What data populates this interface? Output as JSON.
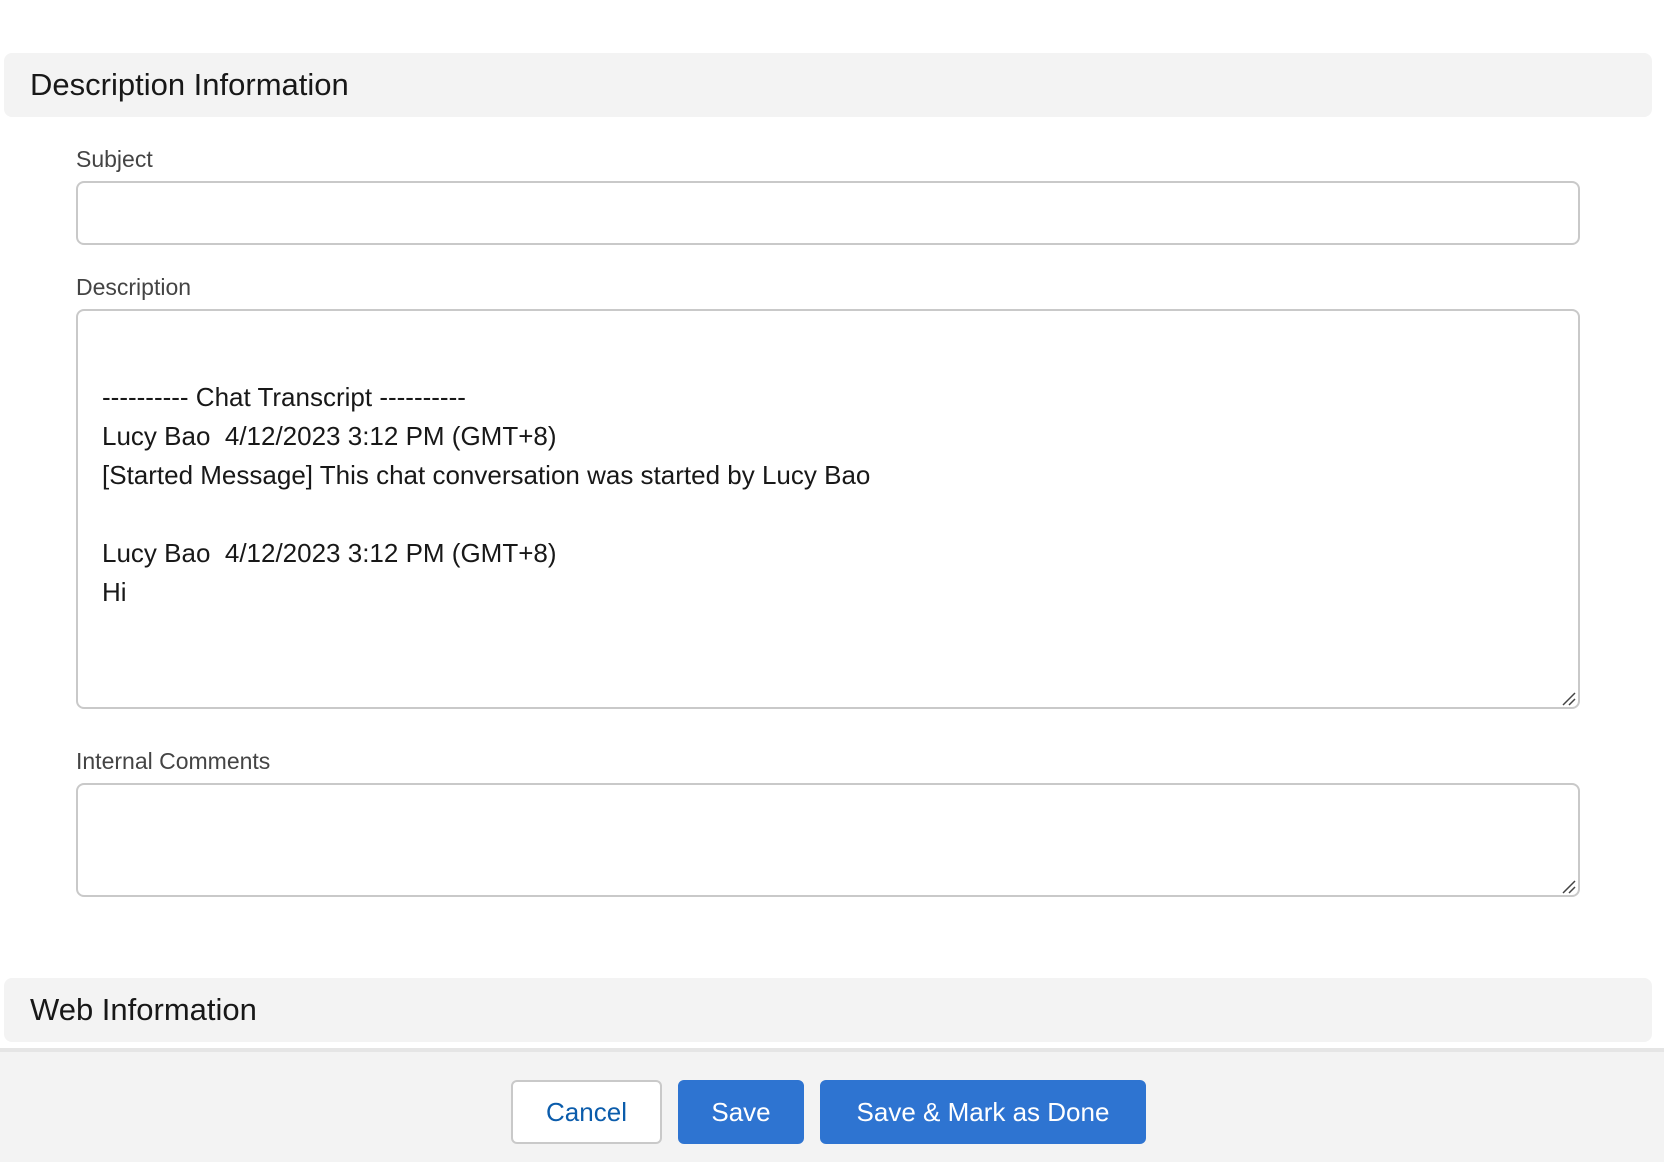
{
  "description_section": {
    "title": "Description Information",
    "subject": {
      "label": "Subject",
      "value": ""
    },
    "description": {
      "label": "Description",
      "value": "\n---------- Chat Transcript ----------\nLucy Bao  4/12/2023 3:12 PM (GMT+8)\n[Started Message] This chat conversation was started by Lucy Bao\n\nLucy Bao  4/12/2023 3:12 PM (GMT+8)\nHi"
    },
    "internal_comments": {
      "label": "Internal Comments",
      "value": ""
    }
  },
  "web_section": {
    "title": "Web Information"
  },
  "footer": {
    "cancel_label": "Cancel",
    "save_label": "Save",
    "save_done_label": "Save & Mark as Done"
  },
  "colors": {
    "brand_blue": "#2e74d1",
    "link_blue": "#0b5cab",
    "section_bg": "#f3f3f3",
    "border": "#c9c9c9"
  },
  "icons": {
    "resize_handle": "resize-handle-icon"
  }
}
